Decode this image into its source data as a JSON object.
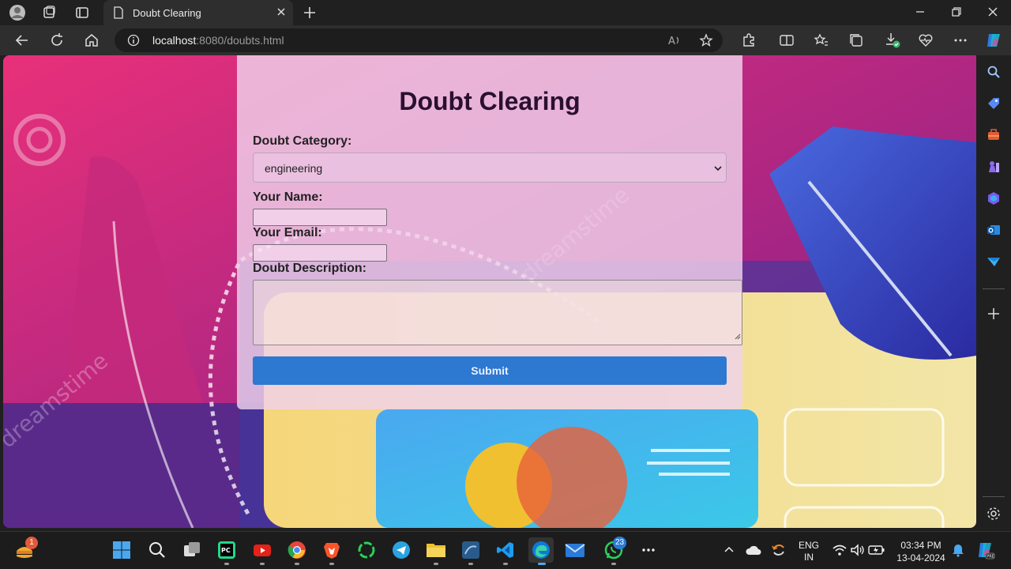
{
  "browser": {
    "tab": {
      "title": "Doubt Clearing"
    },
    "url": {
      "host": "localhost",
      "rest": ":8080/doubts.html"
    }
  },
  "page": {
    "title": "Doubt Clearing",
    "category_label": "Doubt Category:",
    "category_value": "engineering",
    "name_label": "Your Name:",
    "email_label": "Your Email:",
    "description_label": "Doubt Description:",
    "submit_label": "Submit",
    "watermark": "dreamstime"
  },
  "taskbar": {
    "widget_badge": "1",
    "whatsapp_badge": "23",
    "language": {
      "line1": "ENG",
      "line2": "IN"
    },
    "clock": {
      "time": "03:34 PM",
      "date": "13-04-2024"
    }
  },
  "colors": {
    "accent": "#2d78d0",
    "page_bg": "#8e1c8a"
  }
}
